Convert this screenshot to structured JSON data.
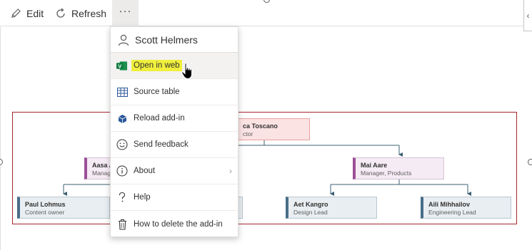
{
  "toolbar": {
    "edit_label": "Edit",
    "refresh_label": "Refresh",
    "more_label": "···",
    "collapse_label": "‹"
  },
  "menu": {
    "user_name": "Scott Helmers",
    "items": [
      {
        "label": "Open in web",
        "icon": "visio-icon"
      },
      {
        "label": "Source table",
        "icon": "table-icon"
      },
      {
        "label": "Reload add-in",
        "icon": "addin-icon"
      },
      {
        "label": "Send feedback",
        "icon": "smiley-icon"
      },
      {
        "label": "About",
        "icon": "info-icon"
      },
      {
        "label": "Help",
        "icon": "question-icon"
      },
      {
        "label": "How to delete the add-in",
        "icon": "trash-icon"
      }
    ]
  },
  "org_chart": {
    "root": {
      "name": "ca Toscano",
      "role": "ctor"
    },
    "left_manager": {
      "name": "Aasa A",
      "role": "Manag"
    },
    "right_manager": {
      "name": "Mai Aare",
      "role": "Manager, Products"
    },
    "reports": [
      {
        "name": "Paul Lohmus",
        "role": "Content owner"
      },
      {
        "name": "Aet Kangro",
        "role": "Design Lead"
      },
      {
        "name": "Aili Mihhailov",
        "role": "Engineering Lead"
      }
    ]
  },
  "colors": {
    "highlight": "#f0ef3c",
    "frame_border": "#a4262c",
    "root_fill": "#fbe3e3",
    "manager_accent": "#9b4f96",
    "report_accent": "#486d88",
    "visio_green": "#107c41"
  }
}
